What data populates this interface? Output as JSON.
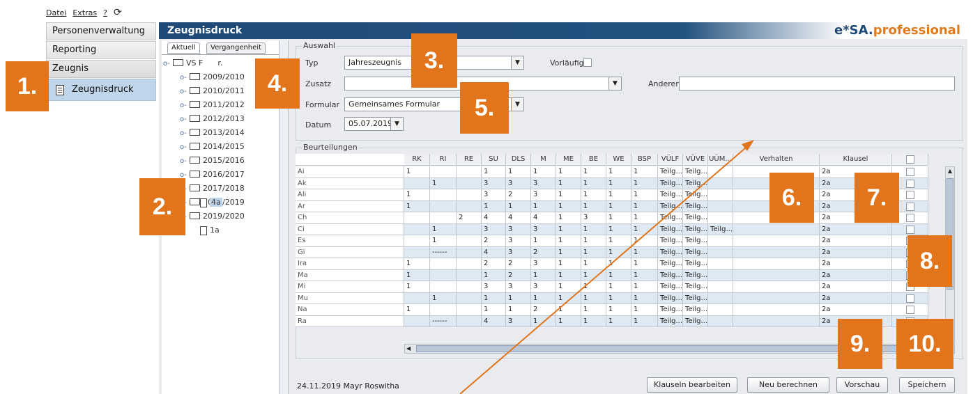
{
  "menu": {
    "items": [
      "Datei",
      "Extras",
      "?"
    ],
    "refresh_icon": "refresh-icon"
  },
  "nav": {
    "items": [
      "Personenverwaltung",
      "Reporting",
      "Zeugnis"
    ],
    "subitem": "Zeugnisdruck"
  },
  "header": {
    "title": "Zeugnisdruck",
    "brand_main": "e*SA.",
    "brand_accent": "professional"
  },
  "tree": {
    "tabs": [
      "Aktuell",
      "Vergangenheit"
    ],
    "root": "VS F",
    "root_suffix": "r.",
    "years": [
      "2009/2010",
      "2010/2011",
      "2011/2012",
      "2012/2013",
      "2013/2014",
      "2014/2015",
      "2015/2016",
      "2016/2017",
      "2017/2018",
      "2018/2019",
      "2019/2020"
    ],
    "class_2018": "4a",
    "class_2019": "1a"
  },
  "auswahl": {
    "title": "Auswahl",
    "typ_label": "Typ",
    "typ_value": "Jahreszeugnis",
    "vorlaeufig_label": "Vorläufig",
    "zusatz_label": "Zusatz",
    "zusatz_value": "",
    "anderer_label": "Anderer",
    "anderer_value": "",
    "formular_label": "Formular",
    "formular_value": "Gemeinsames Formular",
    "datum_label": "Datum",
    "datum_value": "05.07.2019"
  },
  "beurteilungen": {
    "title": "Beurteilungen",
    "columns": [
      "RK",
      "RI",
      "RE",
      "SU",
      "DLS",
      "M",
      "ME",
      "BE",
      "WE",
      "BSP",
      "VÜLF",
      "VÜVE",
      "UÜM...",
      "Verhalten",
      "Klausel"
    ],
    "rows": [
      {
        "name": "Ai",
        "v": [
          "1",
          "",
          "",
          "1",
          "1",
          "1",
          "1",
          "1",
          "1",
          "1",
          "Teilg...",
          "Teilg...",
          "",
          "",
          "2a"
        ]
      },
      {
        "name": "Ak",
        "v": [
          "",
          "1",
          "",
          "3",
          "3",
          "3",
          "1",
          "1",
          "1",
          "1",
          "Teilg...",
          "Teilg...",
          "",
          "",
          "2a"
        ]
      },
      {
        "name": "Ali",
        "v": [
          "1",
          "",
          "",
          "3",
          "2",
          "3",
          "1",
          "1",
          "1",
          "1",
          "Teilg...",
          "Teilg...",
          "",
          "",
          "2a"
        ]
      },
      {
        "name": "Ar",
        "v": [
          "1",
          "",
          "",
          "1",
          "1",
          "1",
          "1",
          "1",
          "1",
          "1",
          "Teilg...",
          "Teilg...",
          "",
          "",
          "2a"
        ]
      },
      {
        "name": "Ch",
        "v": [
          "",
          "",
          "2",
          "4",
          "4",
          "4",
          "1",
          "3",
          "1",
          "1",
          "Teilg...",
          "Teilg...",
          "",
          "",
          "2a"
        ]
      },
      {
        "name": "Ci",
        "v": [
          "",
          "1",
          "",
          "3",
          "3",
          "3",
          "1",
          "1",
          "1",
          "1",
          "Teilg...",
          "Teilg...",
          "Teilg...",
          "",
          "2a"
        ]
      },
      {
        "name": "Es",
        "v": [
          "",
          "1",
          "",
          "2",
          "3",
          "1",
          "1",
          "1",
          "1",
          "1",
          "Teilg...",
          "Teilg...",
          "",
          "",
          "2a"
        ]
      },
      {
        "name": "Gi",
        "v": [
          "",
          "------",
          "",
          "4",
          "3",
          "2",
          "1",
          "1",
          "1",
          "1",
          "Teilg...",
          "Teilg...",
          "",
          "",
          "2a"
        ]
      },
      {
        "name": "Ira",
        "v": [
          "1",
          "",
          "",
          "2",
          "2",
          "3",
          "1",
          "1",
          "1",
          "1",
          "Teilg...",
          "Teilg...",
          "",
          "",
          "2a"
        ]
      },
      {
        "name": "Ma",
        "v": [
          "1",
          "",
          "",
          "1",
          "2",
          "1",
          "1",
          "1",
          "1",
          "1",
          "Teilg...",
          "Teilg...",
          "",
          "",
          "2a"
        ]
      },
      {
        "name": "Mi",
        "v": [
          "1",
          "",
          "",
          "3",
          "3",
          "3",
          "1",
          "1",
          "1",
          "1",
          "Teilg...",
          "Teilg...",
          "",
          "",
          "2a"
        ]
      },
      {
        "name": "Mu",
        "v": [
          "",
          "1",
          "",
          "1",
          "1",
          "1",
          "1",
          "1",
          "1",
          "1",
          "Teilg...",
          "Teilg...",
          "",
          "",
          "2a"
        ]
      },
      {
        "name": "Na",
        "v": [
          "1",
          "",
          "",
          "1",
          "1",
          "2",
          "1",
          "1",
          "1",
          "1",
          "Teilg...",
          "Teilg...",
          "",
          "",
          "2a"
        ]
      },
      {
        "name": "Ra",
        "v": [
          "",
          "------",
          "",
          "4",
          "3",
          "1",
          "1",
          "1",
          "1",
          "1",
          "Teilg...",
          "Teilg...",
          "",
          "",
          "2a"
        ]
      }
    ]
  },
  "footer": {
    "status": "24.11.2019 Mayr Roswitha",
    "buttons": [
      "Klauseln bearbeiten",
      "Neu berechnen",
      "Vorschau",
      "Speichern"
    ]
  },
  "callouts": [
    "1.",
    "2.",
    "3.",
    "4.",
    "5.",
    "6.",
    "7.",
    "8.",
    "9.",
    "10."
  ],
  "colors": {
    "accent": "#e2751b",
    "header": "#1f4a78",
    "selection": "#bfd5ea"
  }
}
